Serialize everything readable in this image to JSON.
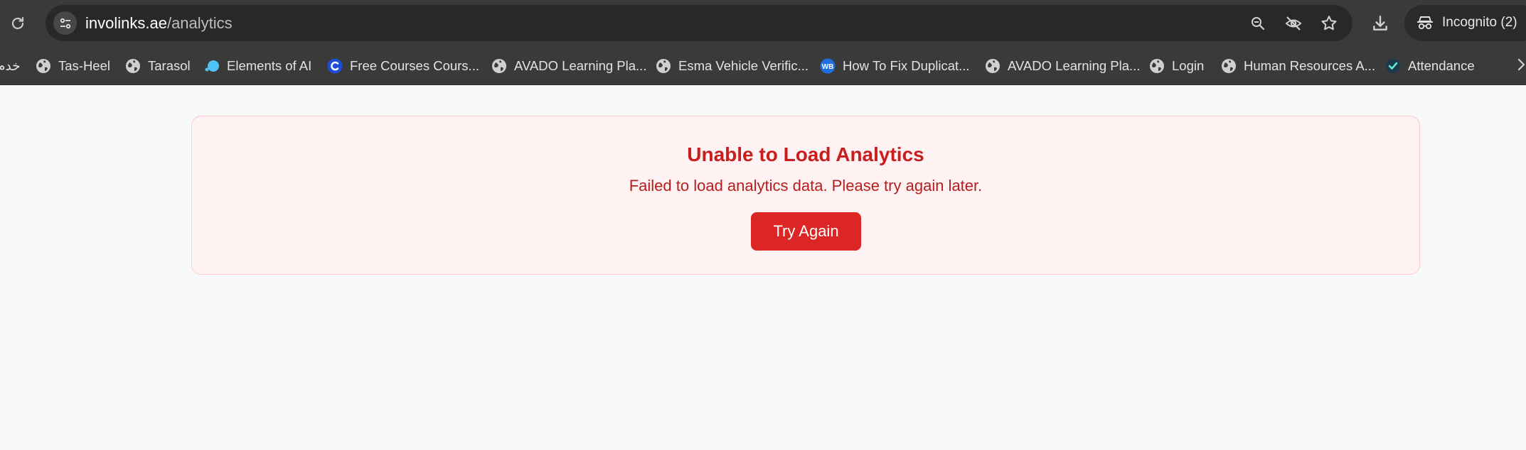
{
  "browser": {
    "url_host": "involinks.ae",
    "url_path": "/analytics",
    "incognito_label": "Incognito (2)",
    "icons": [
      "reload-icon",
      "site-info-icon",
      "zoom-icon",
      "tracking-protection-icon",
      "bookmark-star-icon",
      "download-icon",
      "incognito-icon"
    ]
  },
  "bookmarks": {
    "items": [
      {
        "label": "خدم",
        "icon": "globe-icon"
      },
      {
        "label": "Tas-Heel",
        "icon": "globe-icon"
      },
      {
        "label": "Tarasol",
        "icon": "globe-icon"
      },
      {
        "label": "Elements of AI",
        "icon": "elements-of-ai-icon"
      },
      {
        "label": "Free Courses Cours...",
        "icon": "c-logo-icon"
      },
      {
        "label": "AVADO Learning Pla...",
        "icon": "globe-icon"
      },
      {
        "label": "Esma Vehicle Verific...",
        "icon": "globe-icon"
      },
      {
        "label": "How To Fix Duplicat...",
        "icon": "wb-logo-icon"
      },
      {
        "label": "AVADO Learning Pla...",
        "icon": "globe-icon"
      },
      {
        "label": "Login",
        "icon": "globe-icon"
      },
      {
        "label": "Human Resources A...",
        "icon": "globe-icon"
      },
      {
        "label": "Attendance",
        "icon": "attendance-icon"
      }
    ]
  },
  "error": {
    "title": "Unable to Load Analytics",
    "message": "Failed to load analytics data. Please try again later.",
    "retry_label": "Try Again"
  },
  "colors": {
    "chrome_bg": "#3a3a3a",
    "omnibox_bg": "#282828",
    "page_bg": "#f8f9fb",
    "card_bg": "#fef2f2",
    "card_border": "#fecaca",
    "error_text": "#c81e1e",
    "button_bg": "#dc2626"
  }
}
